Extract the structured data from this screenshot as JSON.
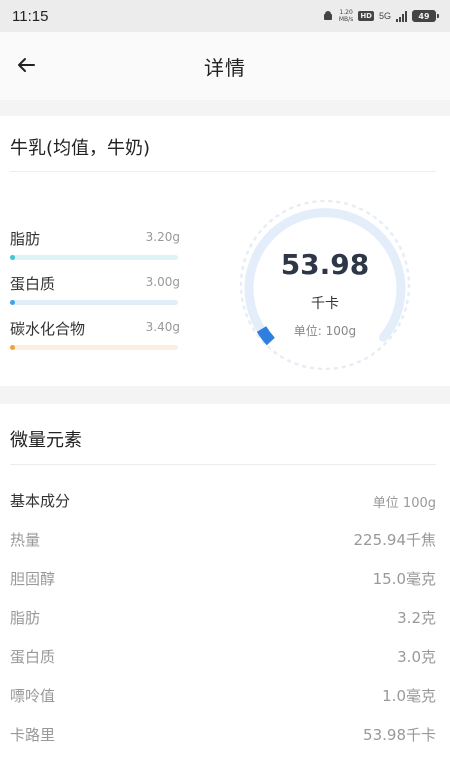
{
  "status_bar": {
    "time": "11:15",
    "net_speed_top": "1.20",
    "net_speed_bottom": "MB/s",
    "hd": "HD",
    "net_type": "5G",
    "battery": "49"
  },
  "header": {
    "title": "详情"
  },
  "food": {
    "name": "牛乳(均值，牛奶)",
    "macros": [
      {
        "label": "脂肪",
        "value": "3.20g",
        "color": "#3ec7d6",
        "bar_color": "#ddf4f7"
      },
      {
        "label": "蛋白质",
        "value": "3.00g",
        "color": "#3aa5e8",
        "bar_color": "#e0eefa"
      },
      {
        "label": "碳水化合物",
        "value": "3.40g",
        "color": "#f0a33a",
        "bar_color": "#fbefe2"
      }
    ]
  },
  "gauge": {
    "value": "53.98",
    "unit": "千卡",
    "per": "单位: 100g",
    "track_color": "#e3eefa",
    "accent_color": "#2f7fe0"
  },
  "micro": {
    "title": "微量元素",
    "basic_title": "基本成分",
    "basic_unit": "单位 100g",
    "rows": [
      {
        "label": "热量",
        "value": "225.94千焦"
      },
      {
        "label": "胆固醇",
        "value": "15.0毫克"
      },
      {
        "label": "脂肪",
        "value": "3.2克"
      },
      {
        "label": "蛋白质",
        "value": "3.0克"
      },
      {
        "label": "嘌呤值",
        "value": "1.0毫克"
      },
      {
        "label": "卡路里",
        "value": "53.98千卡"
      }
    ]
  }
}
